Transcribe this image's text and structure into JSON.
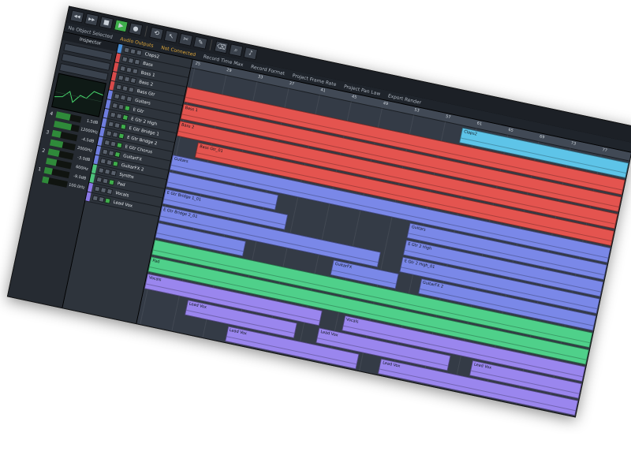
{
  "toolbar": {
    "buttons": [
      "◂◂",
      "▸▸",
      "■",
      "▶",
      "●",
      "⟲",
      "↖",
      "✂",
      "✎",
      "⌫",
      "⌕",
      "♪"
    ]
  },
  "infoline": {
    "left": "No Object Selected",
    "status": "Audio Outputs",
    "connection": "Not Connected",
    "record_time": "Record Time Max",
    "record_format": "Record Format",
    "frame_rate": "Project Frame Rate",
    "pan_law": "Project Pan Law",
    "export": "Export Render"
  },
  "inspector": {
    "title": "Inspector",
    "rows": [
      {
        "num": "4",
        "val": "1.5dB",
        "level": 0.55
      },
      {
        "num": "",
        "val": "12000Hz",
        "level": 0.7
      },
      {
        "num": "3",
        "val": "-4.5dB",
        "level": 0.35
      },
      {
        "num": "",
        "val": "2000Hz",
        "level": 0.5
      },
      {
        "num": "2",
        "val": "-3.0dB",
        "level": 0.45
      },
      {
        "num": "",
        "val": "600Hz",
        "level": 0.4
      },
      {
        "num": "1",
        "val": "-9.0dB",
        "level": 0.3
      },
      {
        "num": "",
        "val": "100.0Hz",
        "level": 0.25
      }
    ]
  },
  "tracks": [
    {
      "name": "Claps2",
      "color": "#4a8fd8",
      "on": false
    },
    {
      "name": "Bass",
      "color": "#d84a4a",
      "on": false
    },
    {
      "name": "Bass 1",
      "color": "#d84a4a",
      "on": false
    },
    {
      "name": "Bass 2",
      "color": "#d84a4a",
      "on": false
    },
    {
      "name": "Bass Gtr",
      "color": "#d84a4a",
      "on": false
    },
    {
      "name": "Guitars",
      "color": "#6f7ee0",
      "on": false
    },
    {
      "name": "E Gtr",
      "color": "#6f7ee0",
      "on": true
    },
    {
      "name": "E Gtr 2 High",
      "color": "#6f7ee0",
      "on": true
    },
    {
      "name": "E Gtr Bridge 1",
      "color": "#6f7ee0",
      "on": true
    },
    {
      "name": "E Gtr Bridge 2",
      "color": "#6f7ee0",
      "on": true
    },
    {
      "name": "E Gtr Chorus",
      "color": "#6f7ee0",
      "on": true
    },
    {
      "name": "GuitarFX",
      "color": "#6f7ee0",
      "on": true
    },
    {
      "name": "GuitarFX 2",
      "color": "#6f7ee0",
      "on": true
    },
    {
      "name": "Synths",
      "color": "#4cc27a",
      "on": false
    },
    {
      "name": "Pad",
      "color": "#4cc27a",
      "on": true
    },
    {
      "name": "Vocals",
      "color": "#8a78e6",
      "on": false
    },
    {
      "name": "Lead Vox",
      "color": "#8a78e6",
      "on": true
    }
  ],
  "ruler": {
    "bars": [
      "25",
      "29",
      "33",
      "37",
      "41",
      "45",
      "49",
      "53",
      "57",
      "61",
      "65",
      "69",
      "73",
      "77"
    ]
  },
  "colors": {
    "red": "#e4544f",
    "blue": "#7a88e8",
    "cyan": "#5ec4e8",
    "green": "#4fd08a",
    "purple": "#9a86ee"
  },
  "lanes": [
    {
      "events": [
        {
          "label": "Claps2",
          "start": 0.62,
          "end": 1.0,
          "color": "#5ec4e8"
        }
      ]
    },
    {
      "events": [
        {
          "label": "",
          "start": 0.0,
          "end": 1.0,
          "color": "#e4544f"
        }
      ]
    },
    {
      "events": [
        {
          "label": "Bass 1",
          "start": 0.0,
          "end": 1.0,
          "color": "#e4544f"
        }
      ]
    },
    {
      "events": [
        {
          "label": "Bass 2",
          "start": 0.0,
          "end": 1.0,
          "color": "#e4544f"
        }
      ]
    },
    {
      "events": [
        {
          "label": "Bass Gtr_01",
          "start": 0.05,
          "end": 1.0,
          "color": "#e4544f"
        }
      ]
    },
    {
      "events": [
        {
          "label": "Guitars",
          "start": 0.0,
          "end": 1.0,
          "color": "#7a88e8"
        }
      ]
    },
    {
      "events": [
        {
          "label": "",
          "start": 0.0,
          "end": 0.25,
          "color": "#7a88e8"
        },
        {
          "label": "Guitars",
          "start": 0.55,
          "end": 1.0,
          "color": "#7a88e8"
        }
      ]
    },
    {
      "events": [
        {
          "label": "E Gtr Bridge 1_01",
          "start": 0.0,
          "end": 0.28,
          "color": "#7a88e8"
        },
        {
          "label": "E Gtr 2 High",
          "start": 0.55,
          "end": 1.0,
          "color": "#7a88e8"
        }
      ]
    },
    {
      "events": [
        {
          "label": "E Gtr Bridge 2_01",
          "start": 0.0,
          "end": 0.5,
          "color": "#7a88e8"
        },
        {
          "label": "E Gtr 2 High_01",
          "start": 0.55,
          "end": 1.0,
          "color": "#7a88e8"
        }
      ]
    },
    {
      "events": [
        {
          "label": "",
          "start": 0.0,
          "end": 0.2,
          "color": "#7a88e8"
        },
        {
          "label": "GuitarFX",
          "start": 0.4,
          "end": 0.55,
          "color": "#7a88e8"
        },
        {
          "label": "GuitarFX 2",
          "start": 0.6,
          "end": 1.0,
          "color": "#7a88e8"
        }
      ]
    },
    {
      "events": [
        {
          "label": "",
          "start": 0.0,
          "end": 1.0,
          "color": "#4fd08a"
        }
      ]
    },
    {
      "events": [
        {
          "label": "Pad",
          "start": 0.0,
          "end": 1.0,
          "color": "#4fd08a"
        }
      ]
    },
    {
      "events": [
        {
          "label": "Vocals",
          "start": 0.0,
          "end": 0.4,
          "color": "#9a86ee"
        },
        {
          "label": "Vocals",
          "start": 0.45,
          "end": 1.0,
          "color": "#9a86ee"
        }
      ]
    },
    {
      "events": [
        {
          "label": "Lead Vox",
          "start": 0.1,
          "end": 0.35,
          "color": "#9a86ee"
        },
        {
          "label": "Lead Vox",
          "start": 0.4,
          "end": 0.7,
          "color": "#9a86ee"
        },
        {
          "label": "Lead Vox",
          "start": 0.75,
          "end": 1.0,
          "color": "#9a86ee"
        }
      ]
    },
    {
      "events": [
        {
          "label": "Lead Vox",
          "start": 0.2,
          "end": 0.5,
          "color": "#9a86ee"
        },
        {
          "label": "Lead Vox",
          "start": 0.55,
          "end": 1.0,
          "color": "#9a86ee"
        }
      ]
    }
  ]
}
